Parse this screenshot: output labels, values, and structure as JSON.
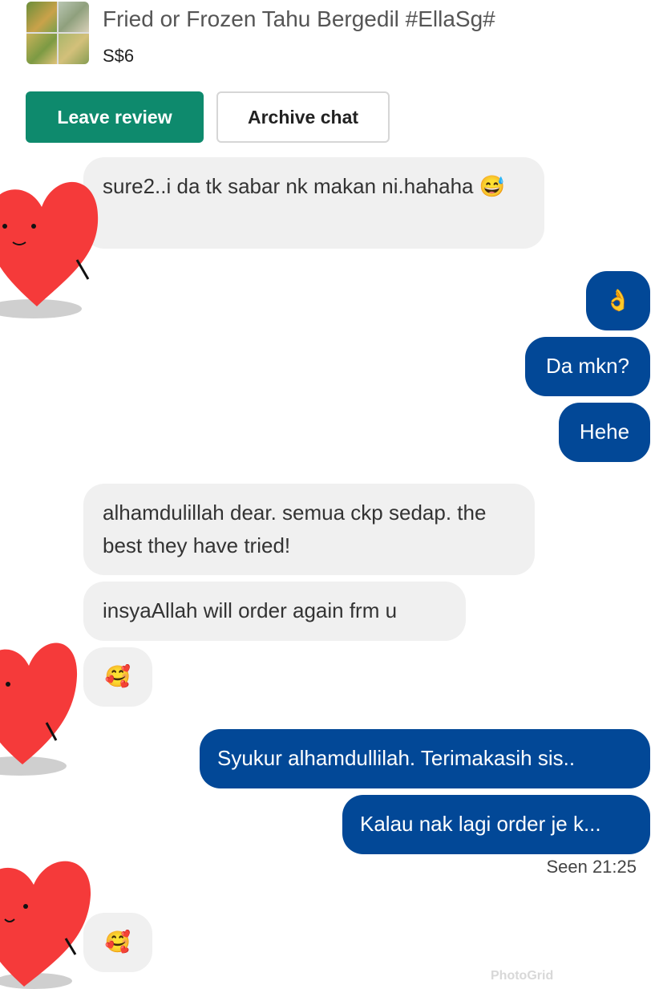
{
  "listing": {
    "title": "Fried or Frozen Tahu Bergedil #EllaSg#",
    "price": "S$6",
    "thumbnail_icon": "food-photo-grid-thumbnail"
  },
  "actions": {
    "leave_review": "Leave review",
    "archive_chat": "Archive chat"
  },
  "messages": [
    {
      "from": "them",
      "text": "sure2..i da tk sabar nk makan ni.hahaha 😅"
    },
    {
      "from": "me",
      "text": "👌"
    },
    {
      "from": "me",
      "text": "Da mkn?"
    },
    {
      "from": "me",
      "text": "Hehe"
    },
    {
      "from": "them",
      "text": "alhamdulillah dear. semua ckp sedap. the best they have tried!"
    },
    {
      "from": "them",
      "text": "insyaAllah will order again frm u"
    },
    {
      "from": "them",
      "text": "🥰"
    },
    {
      "from": "me",
      "text": "Syukur alhamdullilah. Terimakasih sis.."
    },
    {
      "from": "me",
      "text": "Kalau nak lagi order je k..."
    },
    {
      "from": "them",
      "text": "🥰"
    }
  ],
  "status": {
    "seen": "Seen 21:25"
  },
  "overlays": {
    "sticker_icon": "heart-sticker-icon",
    "watermark": "PhotoGrid"
  },
  "colors": {
    "brand_green": "#0e8a6d",
    "outgoing_bubble": "#024897",
    "incoming_bubble": "#f0f0f0",
    "heart": "#f53a3a"
  }
}
